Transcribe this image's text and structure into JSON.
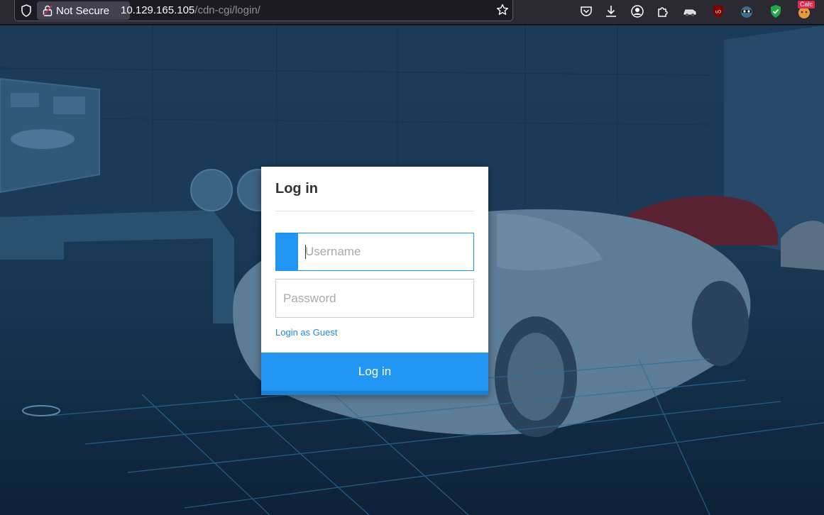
{
  "browser": {
    "security_label": "Not Secure",
    "url_host": "10.129.165.105",
    "url_path": "/cdn-cgi/login/",
    "extension_badge": "Calc"
  },
  "icons": {
    "toolbar": [
      "shield-icon",
      "lock-insecure-icon",
      "bookmark-star-icon",
      "pocket-icon",
      "download-icon",
      "account-icon",
      "extensions-icon",
      "vehicle-extension-icon",
      "ublock-icon",
      "spy-extension-icon",
      "shield-check-extension-icon",
      "calc-extension-icon"
    ]
  },
  "colors": {
    "accent": "#2196f3",
    "accent_dark": "#1c7fd0",
    "link": "#1f88e5",
    "page_bg": "#1a3a57"
  },
  "login": {
    "title": "Log in",
    "username_placeholder": "Username",
    "password_placeholder": "Password",
    "guest_link": "Login as Guest",
    "submit_label": "Log in"
  }
}
